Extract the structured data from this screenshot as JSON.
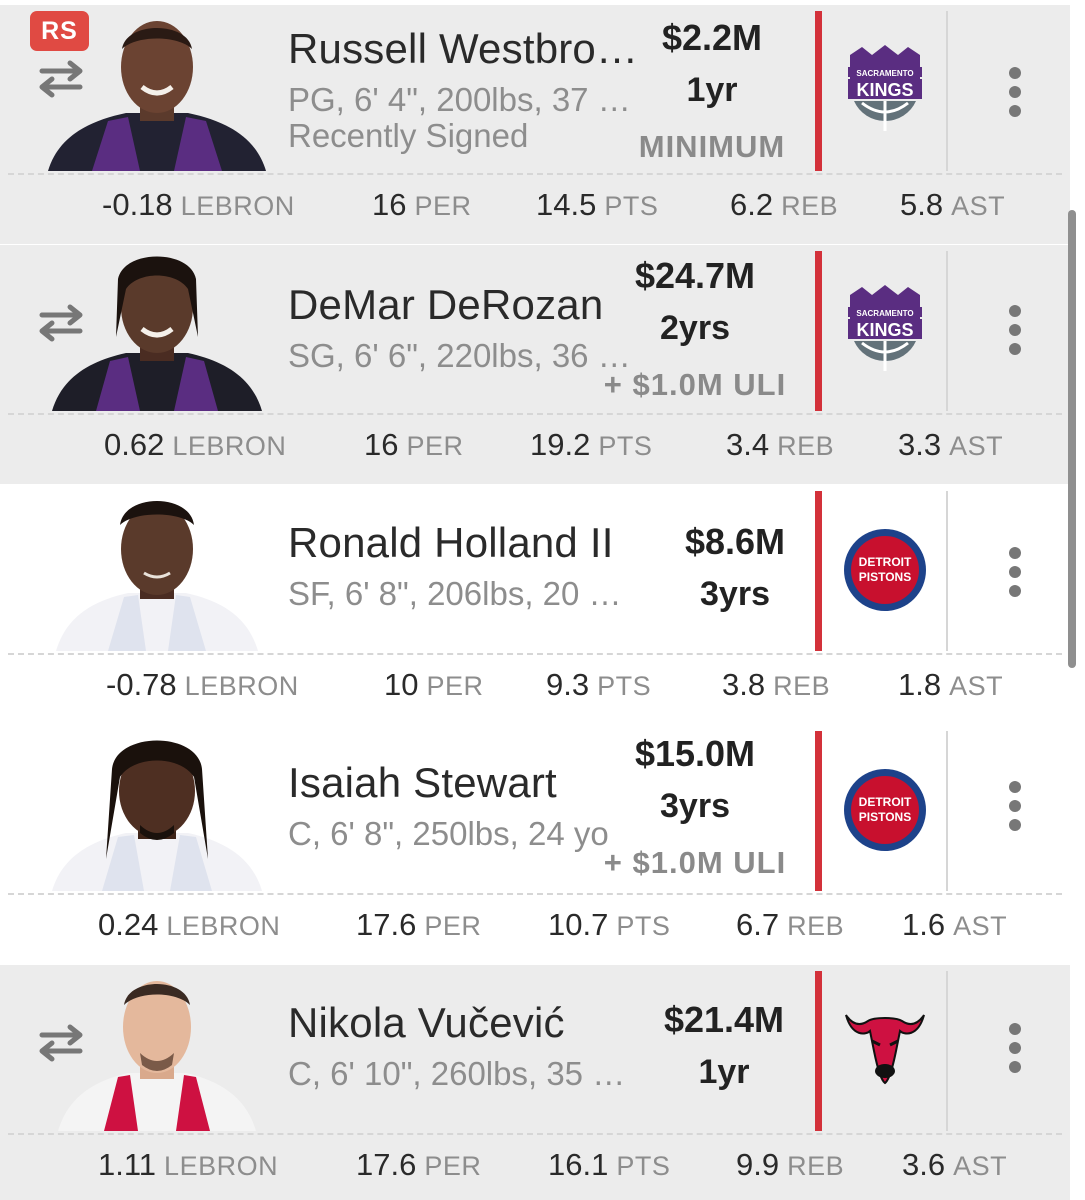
{
  "players": [
    {
      "name": "Russell Westbro…",
      "bio": "PG, 6' 4\", 200lbs, 37 …",
      "note": "Recently Signed",
      "badge": "RS",
      "salary": "$2.2M",
      "years": "1yr",
      "extra": "MINIMUM",
      "team": "kings",
      "stats": {
        "lebron": "-0.18",
        "per": "16",
        "pts": "14.5",
        "reb": "6.2",
        "ast": "5.8"
      }
    },
    {
      "name": "DeMar DeRozan",
      "bio": "SG, 6' 6\", 220lbs, 36 …",
      "salary": "$24.7M",
      "years": "2yrs",
      "extra": "+ $1.0M ULI",
      "team": "kings",
      "stats": {
        "lebron": "0.62",
        "per": "16",
        "pts": "19.2",
        "reb": "3.4",
        "ast": "3.3"
      }
    },
    {
      "name": "Ronald Holland II",
      "bio": "SF, 6' 8\", 206lbs, 20 …",
      "salary": "$8.6M",
      "years": "3yrs",
      "team": "pistons",
      "stats": {
        "lebron": "-0.78",
        "per": "10",
        "pts": "9.3",
        "reb": "3.8",
        "ast": "1.8"
      }
    },
    {
      "name": "Isaiah Stewart",
      "bio": "C, 6' 8\", 250lbs, 24 yo",
      "salary": "$15.0M",
      "years": "3yrs",
      "extra": "+ $1.0M ULI",
      "team": "pistons",
      "stats": {
        "lebron": "0.24",
        "per": "17.6",
        "pts": "10.7",
        "reb": "6.7",
        "ast": "1.6"
      }
    },
    {
      "name": "Nikola Vučević",
      "bio": "C, 6' 10\", 260lbs, 35 …",
      "salary": "$21.4M",
      "years": "1yr",
      "team": "bulls",
      "stats": {
        "lebron": "1.11",
        "per": "17.6",
        "pts": "16.1",
        "reb": "9.9",
        "ast": "3.6"
      }
    }
  ],
  "stat_labels": {
    "lebron": "LEBRON",
    "per": "PER",
    "pts": "PTS",
    "reb": "REB",
    "ast": "AST"
  },
  "logo_text": {
    "kings_top": "SACRAMENTO",
    "kings_bottom": "KINGS",
    "pistons_top": "DETROIT",
    "pistons_bottom": "PISTONS"
  },
  "icons": {
    "trade": "swap-arrows-icon",
    "menu": "kebab-menu-icon"
  },
  "colors": {
    "accent_red": "#d3313a",
    "badge_red": "#e04a43",
    "kings_purple": "#5a2d81",
    "kings_grey": "#63727a",
    "pistons_blue": "#1d428a",
    "pistons_red": "#c8102e",
    "bulls_red": "#ce1141"
  }
}
